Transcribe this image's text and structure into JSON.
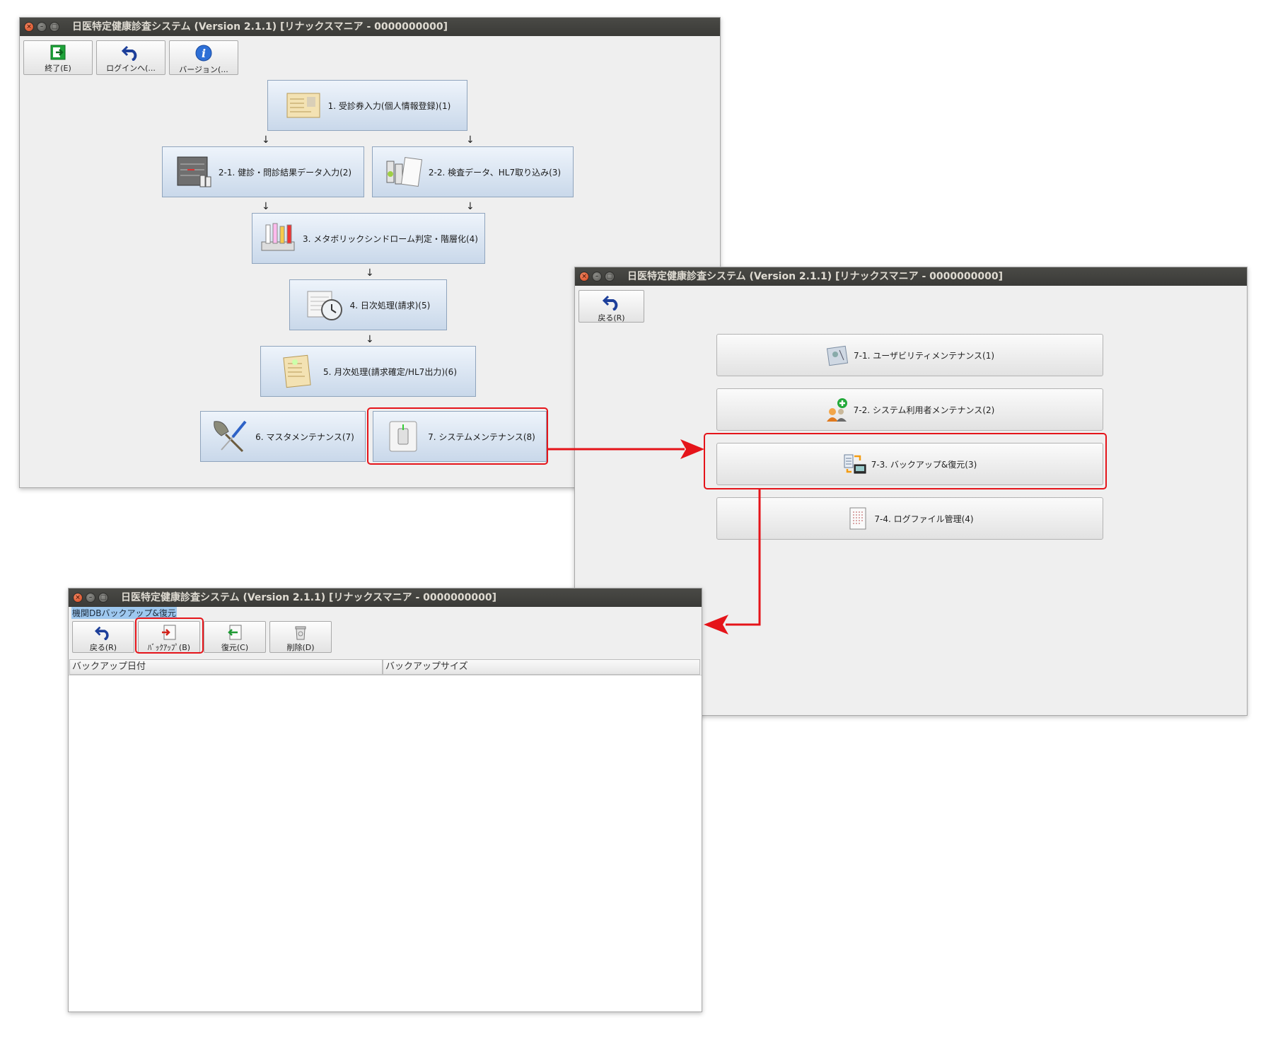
{
  "window_title": "日医特定健康診査システム (Version 2.1.1) [リナックスマニア - 0000000000]",
  "main_window": {
    "toolbar": [
      {
        "id": "exit",
        "label": "終了(E)",
        "icon": "exit-icon"
      },
      {
        "id": "login",
        "label": "ログインへ(...",
        "icon": "back-arrow-icon"
      },
      {
        "id": "version",
        "label": "バージョン(...",
        "icon": "info-icon"
      }
    ],
    "flow": {
      "f1": "1. 受診券入力(個人情報登録)(1)",
      "f21": "2-1. 健診・問診結果データ入力(2)",
      "f22": "2-2. 検査データ、HL7取り込み(3)",
      "f3": "3. メタボリックシンドローム判定・階層化(4)",
      "f4": "4. 日次処理(請求)(5)",
      "f5": "5. 月次処理(請求確定/HL7出力)(6)",
      "f6": "6. マスタメンテナンス(7)",
      "f7": "7. システムメンテナンス(8)"
    }
  },
  "maint_window": {
    "back_label": "戻る(R)",
    "items": [
      {
        "label": "7-1. ユーザビリティメンテナンス(1)",
        "icon": "usability-icon"
      },
      {
        "label": "7-2. システム利用者メンテナンス(2)",
        "icon": "users-icon"
      },
      {
        "label": "7-3. バックアップ&復元(3)",
        "icon": "backup-restore-icon"
      },
      {
        "label": "7-4. ログファイル管理(4)",
        "icon": "log-file-icon"
      }
    ]
  },
  "backup_window": {
    "section_label": "機関DBバックアップ&復元",
    "toolbar": [
      {
        "id": "back",
        "label": "戻る(R)",
        "icon": "back-arrow-icon"
      },
      {
        "id": "backup",
        "label": "ﾊﾞｯｸｱｯﾌﾟ(B)",
        "icon": "backup-icon"
      },
      {
        "id": "restore",
        "label": "復元(C)",
        "icon": "restore-icon"
      },
      {
        "id": "delete",
        "label": "削除(D)",
        "icon": "trash-icon"
      }
    ],
    "columns": [
      "バックアップ日付",
      "バックアップサイズ"
    ]
  },
  "colors": {
    "highlight": "#e5141a",
    "titlebar": "#3c3b37",
    "flow_button": "#c9d8ea"
  }
}
